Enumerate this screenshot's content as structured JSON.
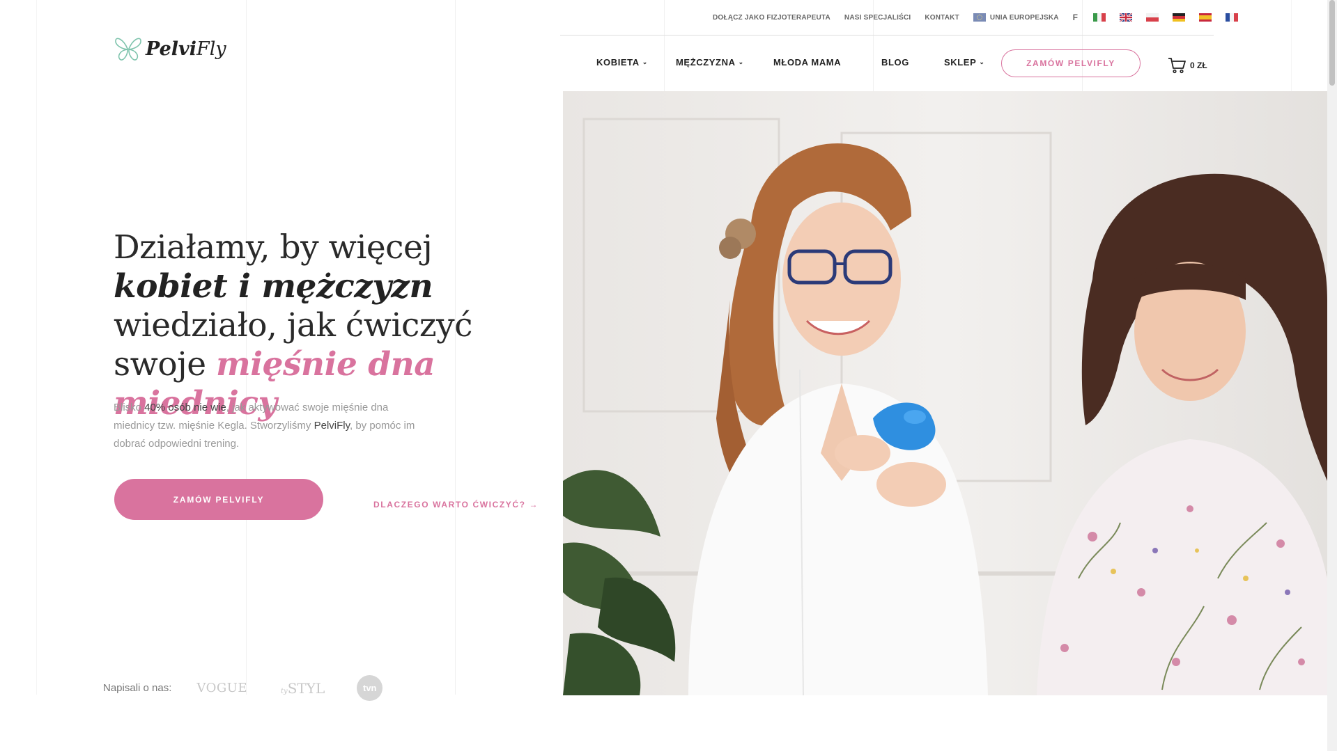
{
  "brand": {
    "logo_bold": "Pelvi",
    "logo_light": "Fly"
  },
  "topbar": {
    "links": [
      "DOŁĄCZ JAKO FIZJOTERAPEUTA",
      "NASI SPECJALIŚCI",
      "KONTAKT"
    ],
    "eu_label": "UNIA EUROPEJSKA",
    "facebook_glyph": "f"
  },
  "nav": {
    "items": [
      {
        "label": "KOBIETA",
        "dropdown": true
      },
      {
        "label": "MĘŻCZYZNA",
        "dropdown": true
      },
      {
        "label": "MŁODA MAMA",
        "dropdown": false
      },
      {
        "label": "BLOG",
        "dropdown": false
      },
      {
        "label": "SKLEP",
        "dropdown": true
      }
    ],
    "order_button": "ZAMÓW PELVIFLY",
    "cart_total": "0 ZŁ"
  },
  "hero": {
    "title_1": "Działamy, by więcej ",
    "title_em1": "kobiet i mężczyzn",
    "title_2": " wiedziało, jak ćwiczyć swoje ",
    "title_em2": "mięśnie dna miednicy",
    "desc_1": "Blisko ",
    "desc_bold1": "40% osób nie wie",
    "desc_2": ", jak aktywować swoje mięśnie dna miednicy tzw. mięśnie Kegla. Stworzyliśmy ",
    "desc_bold2": "PelviFly",
    "desc_3": ", by pomóc im dobrać odpowiedni trening.",
    "cta_label": "ZAMÓW PELVIFLY",
    "why_label": "DLACZEGO WARTO ĆWICZYĆ? →"
  },
  "press": {
    "label": "Napisali o nas:",
    "vogue": "VOGUE",
    "styl_prefix": "ty",
    "styl": "STYL",
    "tvn": "tvn"
  },
  "colors": {
    "accent": "#d9739e",
    "text": "#2a2a2a",
    "muted": "#999999"
  },
  "icons": [
    "butterfly-logo-icon",
    "facebook-icon",
    "eu-flag-icon",
    "flag-it-icon",
    "flag-en-icon",
    "flag-pl-icon",
    "flag-de-icon",
    "flag-es-icon",
    "flag-fr-icon",
    "chevron-down-icon",
    "cart-icon"
  ]
}
